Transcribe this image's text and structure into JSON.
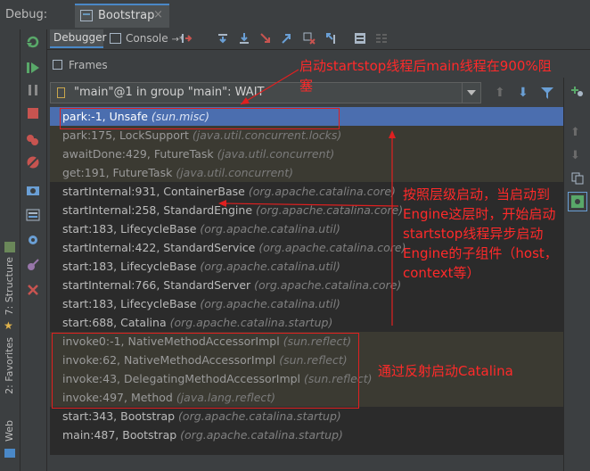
{
  "window": {
    "debug_label": "Debug:",
    "run_tab": "Bootstrap",
    "run_tab_close": "×"
  },
  "tabs": {
    "debugger": "Debugger",
    "console": "Console",
    "console_suffix": "→*"
  },
  "frames_panel": {
    "title": "Frames",
    "thread_selector": "\"main\"@1 in group \"main\": WAIT"
  },
  "side_tabs": {
    "structure": "7: Structure",
    "favorites": "2: Favorites",
    "web": "Web"
  },
  "frames": [
    {
      "method": "park:-1, Unsafe",
      "pkg": "(sun.misc)",
      "state": "selected"
    },
    {
      "method": "park:175, LockSupport",
      "pkg": "(java.util.concurrent.locks)",
      "state": "lib"
    },
    {
      "method": "awaitDone:429, FutureTask",
      "pkg": "(java.util.concurrent)",
      "state": "lib"
    },
    {
      "method": "get:191, FutureTask",
      "pkg": "(java.util.concurrent)",
      "state": "lib"
    },
    {
      "method": "startInternal:931, ContainerBase",
      "pkg": "(org.apache.catalina.core)",
      "state": "normal"
    },
    {
      "method": "startInternal:258, StandardEngine",
      "pkg": "(org.apache.catalina.core)",
      "state": "normal"
    },
    {
      "method": "start:183, LifecycleBase",
      "pkg": "(org.apache.catalina.util)",
      "state": "normal"
    },
    {
      "method": "startInternal:422, StandardService",
      "pkg": "(org.apache.catalina.core)",
      "state": "normal"
    },
    {
      "method": "start:183, LifecycleBase",
      "pkg": "(org.apache.catalina.util)",
      "state": "normal"
    },
    {
      "method": "startInternal:766, StandardServer",
      "pkg": "(org.apache.catalina.core)",
      "state": "normal"
    },
    {
      "method": "start:183, LifecycleBase",
      "pkg": "(org.apache.catalina.util)",
      "state": "normal"
    },
    {
      "method": "start:688, Catalina",
      "pkg": "(org.apache.catalina.startup)",
      "state": "normal"
    },
    {
      "method": "invoke0:-1, NativeMethodAccessorImpl",
      "pkg": "(sun.reflect)",
      "state": "lib"
    },
    {
      "method": "invoke:62, NativeMethodAccessorImpl",
      "pkg": "(sun.reflect)",
      "state": "lib"
    },
    {
      "method": "invoke:43, DelegatingMethodAccessorImpl",
      "pkg": "(sun.reflect)",
      "state": "lib"
    },
    {
      "method": "invoke:497, Method",
      "pkg": "(java.lang.reflect)",
      "state": "lib"
    },
    {
      "method": "start:343, Bootstrap",
      "pkg": "(org.apache.catalina.startup)",
      "state": "normal"
    },
    {
      "method": "main:487, Bootstrap",
      "pkg": "(org.apache.catalina.startup)",
      "state": "normal"
    }
  ],
  "annotations": {
    "top_line1": "启动startstop线程后main线程在900%阻",
    "top_line2": "塞",
    "middle_lines": [
      "按照层级启动，当启动到",
      "Engine这层时，开始启动",
      "startstop线程异步启动",
      "Engine的子组件（host，",
      "context等）"
    ],
    "reflect": "通过反射启动Catalina"
  },
  "colors": {
    "annotation": "#e02020",
    "selection": "#4b6eaf",
    "accent": "#4a88c7"
  }
}
